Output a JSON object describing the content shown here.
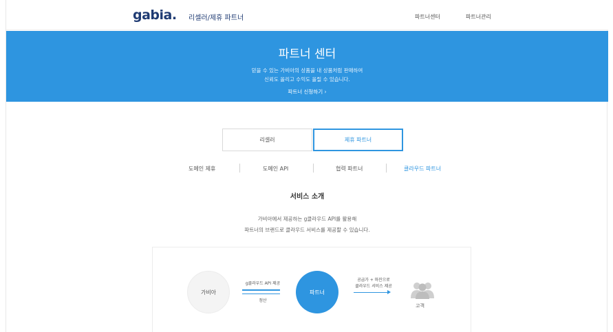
{
  "header": {
    "logo": "gabia.",
    "logo_sub": "리셀러/제휴 파트너",
    "links": [
      "파트너센터",
      "파트너관리"
    ]
  },
  "banner": {
    "title": "파트너 센터",
    "desc_line1": "믿을 수 있는 가비아의 상품을 내 상품처럼 판매하여",
    "desc_line2": "신뢰도 올리고 수익도 올릴 수 있습니다.",
    "cta": "파트너 신청하기 ›"
  },
  "main_tabs": {
    "reseller": "리셀러",
    "partner": "제휴 파트너"
  },
  "sub_nav": [
    "도메인 제휴",
    "도메인 API",
    "협력 파트너",
    "클라우드 파트너"
  ],
  "section": {
    "title": "서비스 소개",
    "desc_line1": "가비아에서 제공하는 g클라우드 API를 활용해",
    "desc_line2": "파트너의 브랜드로 클라우드 서비스를 제공할 수 있습니다."
  },
  "diagram": {
    "node_gabia": "가비아",
    "node_partner": "파트너",
    "flow1_top": "g클라우드 API 제공",
    "flow1_bottom": "정산",
    "flow2_line1": "공급가 + 마진으로",
    "flow2_line2": "클라우드 서비스 제공",
    "customer": "고객"
  },
  "colors": {
    "accent": "#2e95e0",
    "logo": "#1f3b73"
  }
}
